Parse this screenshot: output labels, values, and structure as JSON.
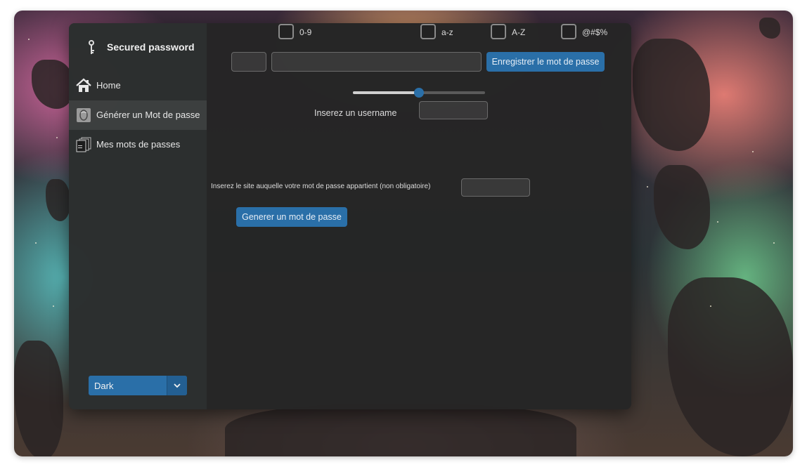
{
  "app": {
    "title": "Secured password"
  },
  "sidebar": {
    "items": [
      {
        "label": "Home",
        "icon": "home-icon"
      },
      {
        "label": "Générer un Mot de passe",
        "icon": "generate-icon",
        "active": true
      },
      {
        "label": "Mes mots de passes",
        "icon": "password-list-icon"
      }
    ],
    "theme": {
      "selected": "Dark"
    }
  },
  "generator": {
    "options": [
      {
        "label": "0-9",
        "checked": false
      },
      {
        "label": "a-z",
        "checked": false
      },
      {
        "label": "A-Z",
        "checked": false
      },
      {
        "label": "@#$%",
        "checked": false
      }
    ],
    "save_button": "Enregistrer le mot de passe",
    "length_slider": {
      "value_fraction": 0.5
    },
    "username_label": "Inserez un username",
    "site_label": "Inserez le site auquelle votre mot de passe appartient (non obligatoire)",
    "generate_button": "Generer un mot de passe"
  },
  "colors": {
    "accent": "#2a6fa8",
    "window_bg": "#282828",
    "sidebar_bg": "#2d3030",
    "text": "#e8e8e8"
  }
}
